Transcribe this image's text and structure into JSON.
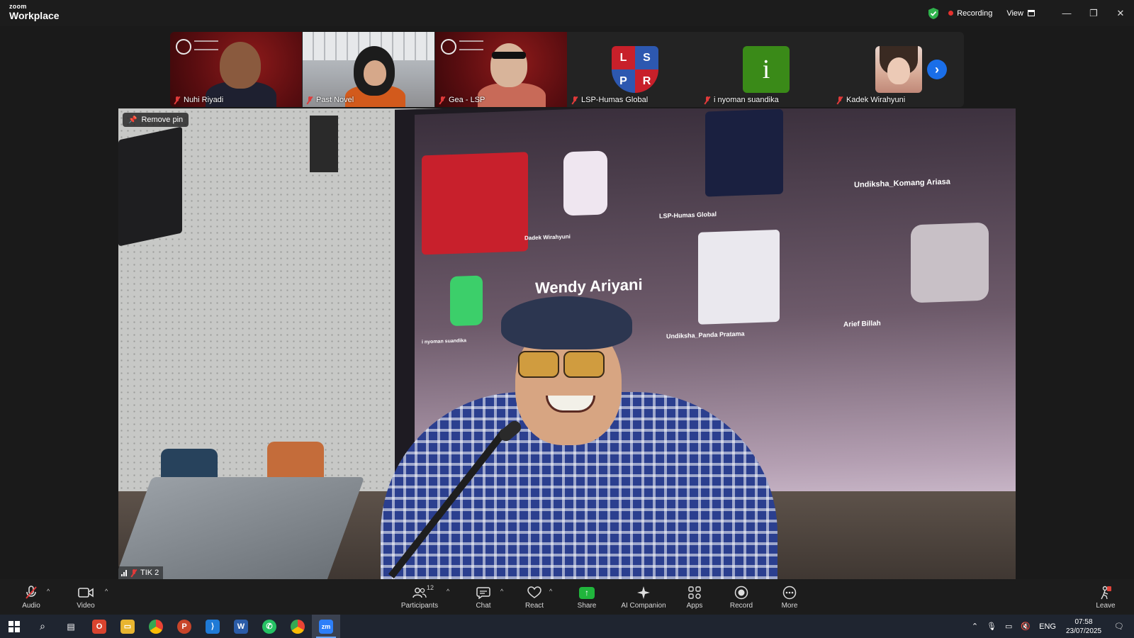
{
  "app": {
    "brand_small": "zoom",
    "brand_large": "Workplace",
    "recording_label": "Recording",
    "view_label": "View"
  },
  "colors": {
    "recording_dot": "#e5312d",
    "accent_blue": "#1a6ee8",
    "share_green": "#20b53c",
    "mute_red": "#e03a3a"
  },
  "thumbnails": [
    {
      "name": "Nuhi Riyadi",
      "kind": "video"
    },
    {
      "name": "Past Novel",
      "kind": "video"
    },
    {
      "name": "Gea - LSP",
      "kind": "video"
    },
    {
      "name": "LSP-Humas Global",
      "kind": "avatar-logo"
    },
    {
      "name": "i nyoman suandika",
      "kind": "avatar-letter",
      "letter": "i"
    },
    {
      "name": "Kadek Wirahyuni",
      "kind": "avatar-photo"
    }
  ],
  "logo_lspr": {
    "q1": "L",
    "q2": "S",
    "q3": "P",
    "q4": "R"
  },
  "main_video": {
    "pin_label": "Remove pin",
    "speaker_name": "TIK 2",
    "screen_name_large": "Wendy Ariyani",
    "screen_labels": [
      "Undiksha_Komang Ariasa",
      "LSP-Humas Global",
      "Dadek Wirahyuni",
      "Undiksha_Panda Pratama",
      "Arief Billah",
      "i nyoman suandika"
    ]
  },
  "toolbar": {
    "audio": "Audio",
    "video": "Video",
    "participants": "Participants",
    "participants_count": "12",
    "chat": "Chat",
    "react": "React",
    "share": "Share",
    "ai_companion": "AI Companion",
    "apps": "Apps",
    "record": "Record",
    "more": "More",
    "leave": "Leave"
  },
  "taskbar": {
    "language": "ENG",
    "time": "07:58",
    "date": "23/07/2025"
  }
}
